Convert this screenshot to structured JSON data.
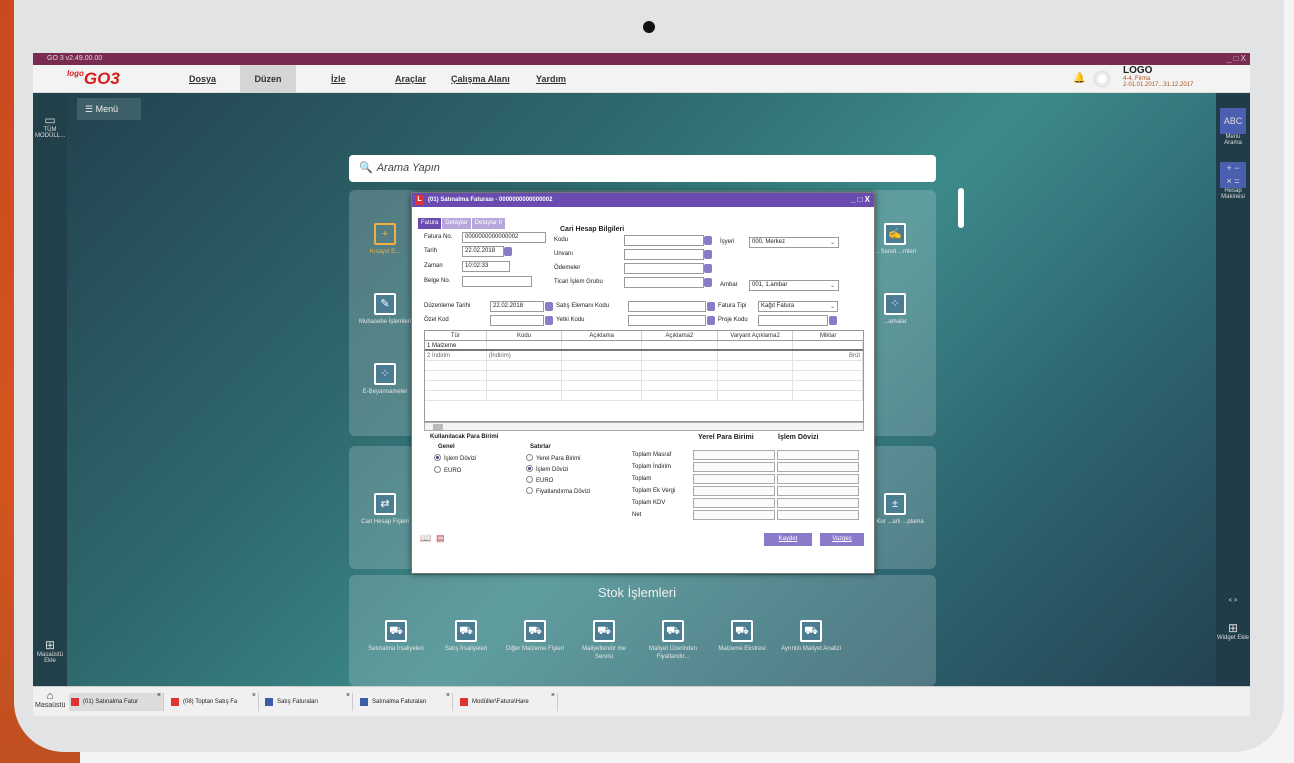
{
  "window": {
    "title": "GO 3 v2.49.00.00",
    "controls": "_ □ X"
  },
  "menu": {
    "brand": "GO3",
    "brand_small": "logo",
    "items": [
      "Dosya",
      "Düzen",
      "İzle",
      "Araçlar",
      "Çalışma Alanı",
      "Yardım"
    ],
    "active": "Düzen"
  },
  "company": {
    "name": "LOGO",
    "firm": "4-4, Firma",
    "period": "2-01.01.2017...31.12.2017"
  },
  "left_sidebar": {
    "all_modules": "TÜM MODÜLL...",
    "desktop_add": "Masaüstü Ekle"
  },
  "right_sidebar": {
    "menu_search": "Menu Arama",
    "calculator": "Hesap Makinesi",
    "widget_add": "Widget Ekle",
    "nav": "< >"
  },
  "menu_button": "Menü",
  "search": {
    "placeholder": "Arama Yapın"
  },
  "tiles_left": [
    "Kısayol E...",
    "Muhasebe İşlemleri",
    "E-Beyannameler",
    "Cari Hesap Fişleri"
  ],
  "tiles_right": [
    "... Senet ...mleri",
    "...amalar",
    "...a Kur ...arlı ...plama"
  ],
  "stock_section": {
    "title": "Stok İşlemleri",
    "tiles": [
      "Satınalma İrsaliyeleri",
      "Satış İrsaliyeleri",
      "Diğer Malzeme Fişleri",
      "Maliyetlendir me Servisi",
      "Maliyet Üzerinden Fiyatlandır...",
      "Malzeme Ekstresi",
      "Ayrıntılı Maliyet Analizi"
    ]
  },
  "dialog": {
    "title": "(01) Satınalma Faturası - 0000000000000002",
    "controls": "_ □ X",
    "tabs": [
      "Fatura",
      "Detaylar",
      "Detaylar II"
    ],
    "labels": {
      "fatura_no": "Fatura No.",
      "tarih": "Tarih",
      "zaman": "Zaman",
      "belge_no": "Belge No.",
      "cari_title": "Cari Hesap Bilgileri",
      "kodu": "Kodu",
      "unvani": "Unvanı",
      "odemeler": "Ödemeler",
      "ticari": "Ticari İşlem Grubu",
      "isyeri": "İşyeri",
      "ambar": "Ambar",
      "duzenleme": "Düzenleme Tarihi",
      "ozel": "Özel Kod",
      "satis_eleman": "Satış Elemanı Kodu",
      "yetki": "Yetki Kodu",
      "fatura_tipi": "Fatura Tipi",
      "proje": "Proje Kodu"
    },
    "values": {
      "fatura_no": "0000000000000002",
      "tarih": "22.02.2018",
      "zaman": "10:02:33",
      "isyeri": "000, Merkez",
      "ambar": "001, 1.ambar",
      "duzenleme": "22.02.2018",
      "fatura_tipi": "Kağıt Fatura"
    },
    "grid": {
      "columns": [
        "Tür",
        "Kodu",
        "Açıklama",
        "Açıklama2",
        "Varyant Açıklama2",
        "Miktar"
      ],
      "rows": [
        [
          "1  Malzeme",
          "",
          "",
          "",
          "",
          ""
        ],
        [
          "2  İndirim",
          "(İndirim)",
          "",
          "",
          "",
          "Brüt"
        ]
      ]
    },
    "currency": {
      "title": "Kullanılacak Para Birimi",
      "genel": "Genel",
      "genel_opts": [
        "İşlem Dövizi",
        "EURO"
      ],
      "satirlar": "Satırlar",
      "satir_opts": [
        "Yerel Para Birimi",
        "İşlem Dövizi",
        "EURO",
        "Fiyatlandırma Dövizi"
      ]
    },
    "totals": {
      "col1": "Yerel Para Birimi",
      "col2": "İşlem Dövizi",
      "rows": [
        "Toplam Masraf",
        "Toplam İndirim",
        "Toplam",
        "Toplam Ek Vergi",
        "Toplam KDV",
        "Net"
      ]
    },
    "buttons": {
      "save": "Kaydet",
      "cancel": "Vazgeç"
    }
  },
  "taskbar": {
    "home": "Masaüstü",
    "items": [
      "(01) Satınalma Fatur",
      "(08) Toptan Satış Fa",
      "Satış Faturaları",
      "Satınalma Faturaları",
      "Modüller\\Fatura\\Hare"
    ]
  }
}
